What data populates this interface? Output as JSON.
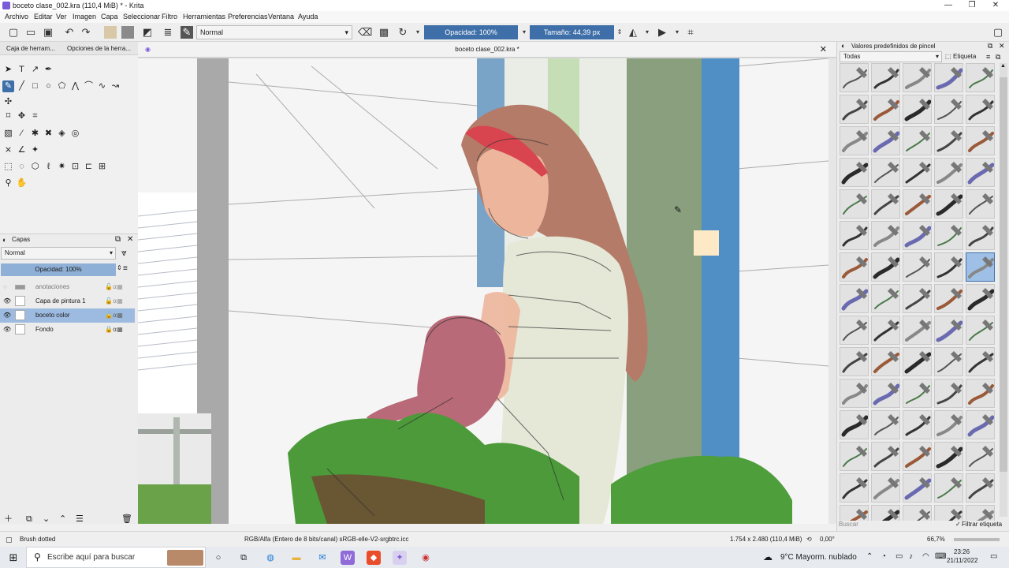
{
  "window": {
    "title": "boceto clase_002.kra (110,4 MiB)  * - Krita",
    "minimize": "—",
    "restore": "❐",
    "close": "✕"
  },
  "menu": [
    "Archivo",
    "Editar",
    "Ver",
    "Imagen",
    "Capa",
    "Seleccionar",
    "Filtro",
    "Herramientas",
    "Preferencias",
    "Ventana",
    "Ayud‌a"
  ],
  "toolbar": {
    "blend_mode": "Normal",
    "opacity": "Opacidad: 100%",
    "size": "Tamaño: 44,39 px"
  },
  "left_tabs": [
    "Caja de herram...",
    "Opciones de la herra..."
  ],
  "layers_panel": {
    "title": "Capas",
    "blend_mode": "Normal",
    "opacity": "Opacidad:  100%",
    "layers": [
      {
        "name": "anotaciones",
        "visible": false,
        "locked": false,
        "selected": false
      },
      {
        "name": "Capa de pintura 1",
        "visible": true,
        "locked": false,
        "selected": false
      },
      {
        "name": "boceto color",
        "visible": true,
        "locked": false,
        "selected": true
      },
      {
        "name": "Fondo",
        "visible": true,
        "locked": true,
        "selected": false
      }
    ]
  },
  "canvas": {
    "doc_title": "boceto clase_002.kra *"
  },
  "brush_panel": {
    "title": "Valores predefinidos de pincel",
    "filter": "Todas",
    "tag_label": "Etiqueta",
    "search_placeholder": "Buscar",
    "filter_tag": "Filtrar etiqueta"
  },
  "status": {
    "brush": "Brush dotted",
    "color_model": "RGB/Alfa (Entero de 8 bits/canal)  sRGB-elle-V2-srgbtrc.icc",
    "dimensions": "1.754 x 2.480 (110,4 MiB)",
    "rotation": "0,00°",
    "zoom": "66,7%"
  },
  "taskbar": {
    "search_placeholder": "Escribe aquí para buscar",
    "weather": "9°C  Mayorm. nublado",
    "time": "23:26",
    "date": "21/11/2022"
  }
}
